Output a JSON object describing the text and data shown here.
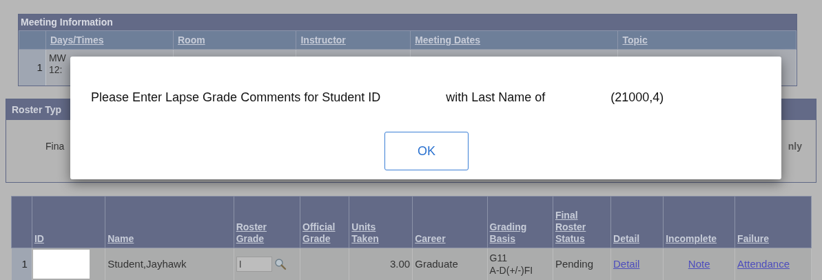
{
  "meeting_information": {
    "title": "Meeting Information",
    "columns": [
      "Days/Times",
      "Room",
      "Instructor",
      "Meeting Dates",
      "Topic"
    ],
    "rows": [
      {
        "number": "1",
        "days_times": [
          "MW",
          "12:"
        ]
      }
    ]
  },
  "roster_type": {
    "title": "Roster Typ",
    "left_text": "Fina",
    "right_text": "nly"
  },
  "dialog": {
    "message_parts": [
      "Please Enter Lapse Grade Comments for Student ID",
      "with Last Name of",
      "(21000,4)"
    ],
    "button": "OK"
  },
  "roster": {
    "columns": [
      "ID",
      "Name",
      "Roster Grade",
      "Official Grade",
      "Units Taken",
      "Career",
      "Grading Basis",
      "Final Roster Status",
      "Detail",
      "Incomplete",
      "Failure"
    ],
    "rows": [
      {
        "number": "1",
        "cells": [
          {
            "kind": "redacted"
          },
          {
            "kind": "text",
            "text": "Student,Jayhawk"
          },
          {
            "kind": "input",
            "value": "I"
          },
          {
            "kind": "empty"
          },
          {
            "kind": "number",
            "text": "3.00"
          },
          {
            "kind": "text",
            "text": "Graduate"
          },
          {
            "kind": "lines",
            "lines": [
              "G11",
              "A-D(+/-)FI"
            ]
          },
          {
            "kind": "text",
            "text": "Pending"
          },
          {
            "kind": "link",
            "text": "Detail"
          },
          {
            "kind": "link",
            "text": "Note"
          },
          {
            "kind": "link",
            "text": "Attendance"
          }
        ]
      }
    ]
  }
}
